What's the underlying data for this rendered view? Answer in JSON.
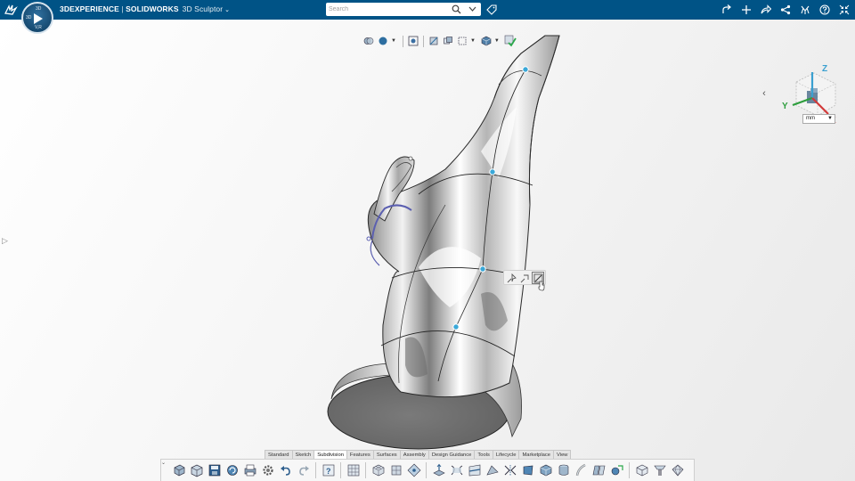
{
  "topbar": {
    "compass": {
      "top_label": "3D",
      "left_label": "3D",
      "bottom_label": "V,R"
    },
    "brand": "3DEXPERIENCE",
    "separator": " | ",
    "product": "SOLIDWORKS",
    "role": "3D Sculptor",
    "search": {
      "placeholder": "Search",
      "value": ""
    },
    "right_icons": [
      "share-arrow-icon",
      "add-icon",
      "forward-icon",
      "share-network-icon",
      "community-icon",
      "help-icon",
      "collapse-icon"
    ]
  },
  "viewport": {
    "units": {
      "selected": "mm"
    },
    "triad": {
      "x": "X",
      "y": "Y",
      "z": "Z"
    }
  },
  "command_tabs": [
    "Standard",
    "Sketch",
    "Subdivision",
    "Features",
    "Surfaces",
    "Assembly",
    "Design Guidance",
    "Tools",
    "Lifecycle",
    "Marketplace",
    "View"
  ],
  "active_tab": "Subdivision",
  "colors": {
    "topbar": "#005386",
    "accent_control_point": "#3aa8d8",
    "selection": "#5b5fb0"
  }
}
